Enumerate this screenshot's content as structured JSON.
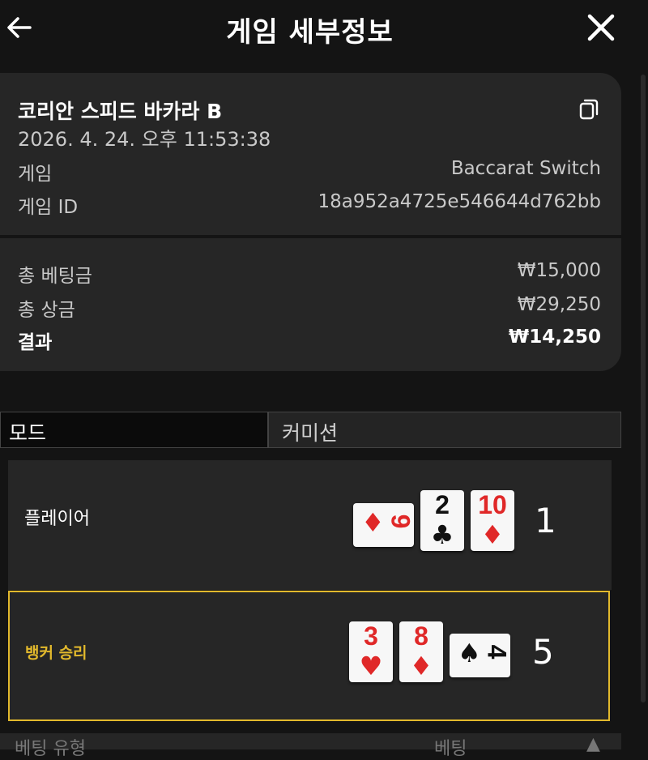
{
  "header": {
    "title": "게임 세부정보"
  },
  "game": {
    "name": "코리안 스피드 바카라 B",
    "datetime": "2026. 4. 24. 오후 11:53:38",
    "type_label": "게임",
    "type_value": "Baccarat Switch",
    "id_label": "게임 ID",
    "id_value": "18a952a4725e546644d762bb"
  },
  "totals": {
    "bet_label": "총 베팅금",
    "bet_value": "₩15,000",
    "payout_label": "총 상금",
    "payout_value": "₩29,250",
    "result_label": "결과",
    "result_value": "₩14,250"
  },
  "mode": {
    "label": "모드",
    "value": "커미션"
  },
  "player": {
    "label": "플레이어",
    "score": "1",
    "cards": [
      {
        "rank": "9",
        "suit": "♦",
        "color": "#e02828"
      },
      {
        "rank": "2",
        "suit": "♣",
        "color": "#111111"
      },
      {
        "rank": "10",
        "suit": "♦",
        "color": "#e02828"
      }
    ]
  },
  "banker": {
    "label": "뱅커 승리",
    "score": "5",
    "cards": [
      {
        "rank": "3",
        "suit": "♥",
        "color": "#e02828"
      },
      {
        "rank": "8",
        "suit": "♦",
        "color": "#e02828"
      },
      {
        "rank": "4",
        "suit": "♠",
        "color": "#111111"
      }
    ]
  },
  "footer": {
    "left": "베팅 유형",
    "mid": "베팅",
    "arrow": "▲"
  },
  "colors": {
    "accent": "#e2b92c",
    "card_red": "#e02828",
    "panel": "#262626",
    "background": "#141414"
  },
  "icons": {
    "back": "arrow-left-icon",
    "close": "close-icon",
    "copy": "copy-icon"
  }
}
